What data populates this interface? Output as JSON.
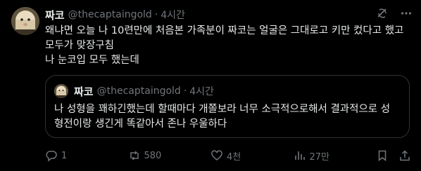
{
  "post": {
    "author_name": "짜코",
    "author_handle": "@thecaptaingold",
    "separator": "·",
    "time": "4시간",
    "text_lines": [
      "왜냐면 오늘 나 10련만에 처음본 가족분이 짜코는 얼굴은 그대로고 키만 컸다고 했고",
      "모두가 맞장구침",
      "나 눈코입 모두 했는데"
    ]
  },
  "quote": {
    "author_name": "짜코",
    "author_handle": "@thecaptaingold",
    "separator": "·",
    "time": "4시간",
    "text_lines": [
      "나 성형을 꽤하긴했는데 할때마다 개쫄보라 너무 소극적으로해서 결과적으로 성",
      "형전이랑 생긴게 똑같아서 존나 우울하다"
    ]
  },
  "actions": {
    "reply_count": "1",
    "repost_count": "580",
    "like_count": "4천",
    "view_count": "27만"
  },
  "icons": {
    "grok": "grok-icon",
    "more": "more-icon",
    "reply": "reply-icon",
    "repost": "repost-icon",
    "like": "heart-icon",
    "views": "views-icon",
    "bookmark": "bookmark-icon",
    "share": "share-icon"
  },
  "colors": {
    "background": "#000000",
    "text": "#e7e9ea",
    "muted": "#71767b",
    "border": "#2f3336"
  }
}
